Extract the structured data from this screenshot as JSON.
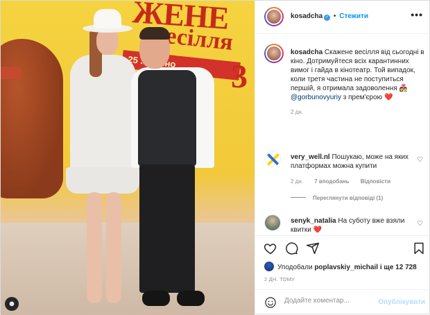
{
  "post": {
    "image_alt_icon": "user-tag-icon"
  },
  "header": {
    "username": "kosadcha",
    "separator": "•",
    "follow_label": "Стежити",
    "more_icon": "more-options-icon"
  },
  "caption": {
    "username": "kosadcha",
    "text": "Скажене весілля від сьогодні в кіно. Дотримуйтеся всіх карантинних вимог і гайда в кінотеатр. Той випадок, коли третя частина не поступиться першій, я отримала задоволення 👩‍❤️‍👨",
    "mention": "@gorbunovyuriy",
    "text_after": "з прем'єрою",
    "emoji": "❤️",
    "age": "2 дн."
  },
  "comments": [
    {
      "username": "very_well.nl",
      "text": "Пошукаю, може на яких платформах можна купити",
      "age": "2 дн.",
      "likes": "7 вподобань",
      "reply_label": "Відповісти",
      "view_replies": "Переглянути відповіді (1)"
    },
    {
      "username": "senyk_natalia",
      "text": "На суботу вже взяли квитки",
      "emoji": "❤️"
    }
  ],
  "actions": {
    "like_icon": "heart-icon",
    "comment_icon": "comment-icon",
    "share_icon": "share-icon",
    "save_icon": "bookmark-icon"
  },
  "likes": {
    "prefix": "Уподобали",
    "user": "poplavskiy_michail",
    "suffix": "і ще 12 728"
  },
  "timestamp": "2 ДН. ТОМУ",
  "add_comment": {
    "placeholder": "Додайте коментар...",
    "publish_label": "Опублікувати"
  },
  "colors": {
    "link_blue": "#0095f6",
    "publish_disabled": "#b2dffc",
    "mention": "#00376b",
    "heart": "#ed4956"
  }
}
